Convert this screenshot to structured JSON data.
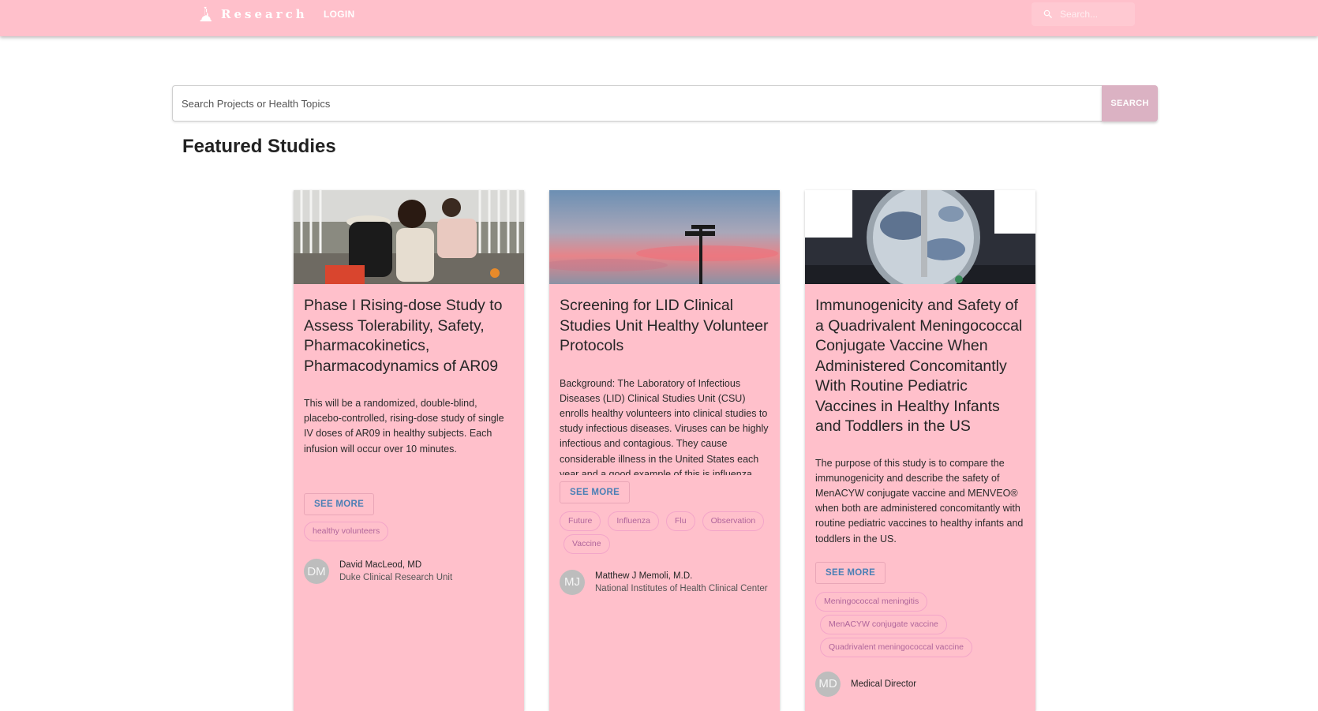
{
  "header": {
    "brand": "Research",
    "login_label": "LOGIN",
    "search_placeholder": "Search..."
  },
  "main_search": {
    "placeholder": "Search Projects or Health Topics",
    "button_label": "SEARCH"
  },
  "section_title": "Featured Studies",
  "cards": [
    {
      "title": "Phase I Rising-dose Study to Assess Tolerability, Safety, Pharmacokinetics, Pharmacodynamics of AR09",
      "description": "This will be a randomized, double-blind, placebo-controlled, rising-dose study of single IV doses of AR09 in healthy subjects. Each infusion will occur over 10 minutes.",
      "see_more": "SEE MORE",
      "tags": [
        "healthy volunteers"
      ],
      "author_initials": "DM",
      "author_name": "David MacLeod, MD",
      "author_org": "Duke Clinical Research Unit"
    },
    {
      "title": "Screening for LID Clinical Studies Unit Healthy Volunteer Protocols",
      "description": "Background: The Laboratory of Infectious Diseases (LID) Clinical Studies Unit (CSU) enrolls healthy volunteers into clinical studies to study infectious diseases. Viruses can be highly infectious and contagious. They cause considerable illness in the United States each year and a good example of this is influenza",
      "see_more": "SEE MORE",
      "tags": [
        "Future",
        "Influenza",
        "Flu",
        "Observation",
        "Vaccine"
      ],
      "author_initials": "MJ",
      "author_name": "Matthew J Memoli, M.D.",
      "author_org": "National Institutes of Health Clinical Center"
    },
    {
      "title": "Immunogenicity and Safety of a Quadrivalent Meningococcal Conjugate Vaccine When Administered Concomitantly With Routine Pediatric Vaccines in Healthy Infants and Toddlers in the US",
      "description": "The purpose of this study is to compare the immunogenicity and describe the safety of MenACYW conjugate vaccine and MENVEO® when both are administered concomitantly with routine pediatric vaccines to healthy infants and toddlers in the US.",
      "see_more": "SEE MORE",
      "tags": [
        "Meningococcal meningitis",
        "MenACYW conjugate vaccine",
        "Quadrivalent meningococcal vaccine"
      ],
      "author_initials": "MD",
      "author_name": "Medical Director",
      "author_org": ""
    }
  ]
}
